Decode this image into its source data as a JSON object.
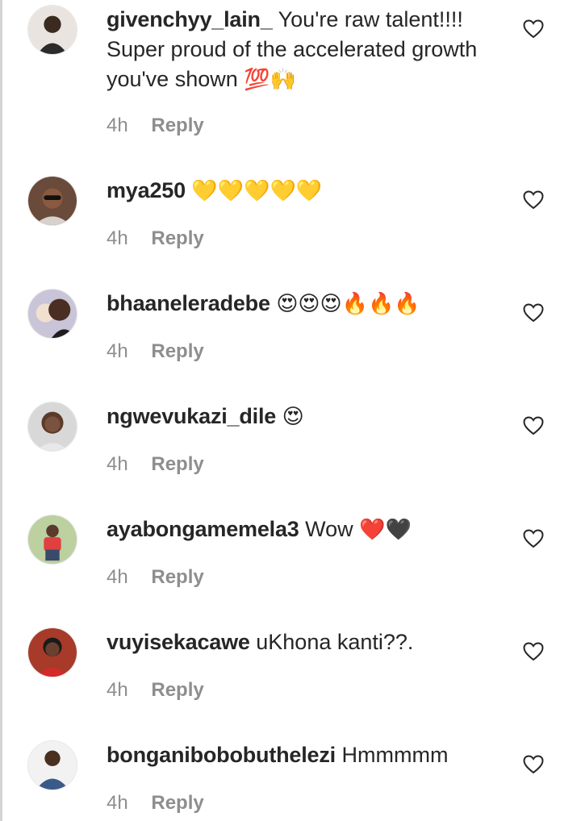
{
  "comments": [
    {
      "username": "givenchyy_lain_",
      "text": "You're raw talent!!!! Super proud of the accelerated growth you've shown",
      "emoji": "💯🙌",
      "time": "4h",
      "reply": "Reply"
    },
    {
      "username": "mya250",
      "text": "",
      "emoji": "💛💛💛💛💛",
      "time": "4h",
      "reply": "Reply"
    },
    {
      "username": "bhaaneleradebe",
      "text": "",
      "emoji": "😍😍😍🔥🔥🔥",
      "time": "4h",
      "reply": "Reply"
    },
    {
      "username": "ngwevukazi_dile",
      "text": "",
      "emoji": "😍",
      "time": "4h",
      "reply": "Reply"
    },
    {
      "username": "ayabongamemela3",
      "text": "Wow",
      "emoji": "❤️🖤",
      "time": "4h",
      "reply": "Reply"
    },
    {
      "username": "vuyisekacawe",
      "text": "uKhona kanti??.",
      "emoji": "",
      "time": "4h",
      "reply": "Reply"
    },
    {
      "username": "bonganibobobuthelezi",
      "text": "Hmmmmm",
      "emoji": "",
      "time": "4h",
      "reply": "Reply"
    }
  ],
  "colors": {
    "text": "#262626",
    "meta": "#8e8e8e",
    "background": "#ffffff"
  },
  "icons": {
    "like": "heart-outline-icon"
  }
}
